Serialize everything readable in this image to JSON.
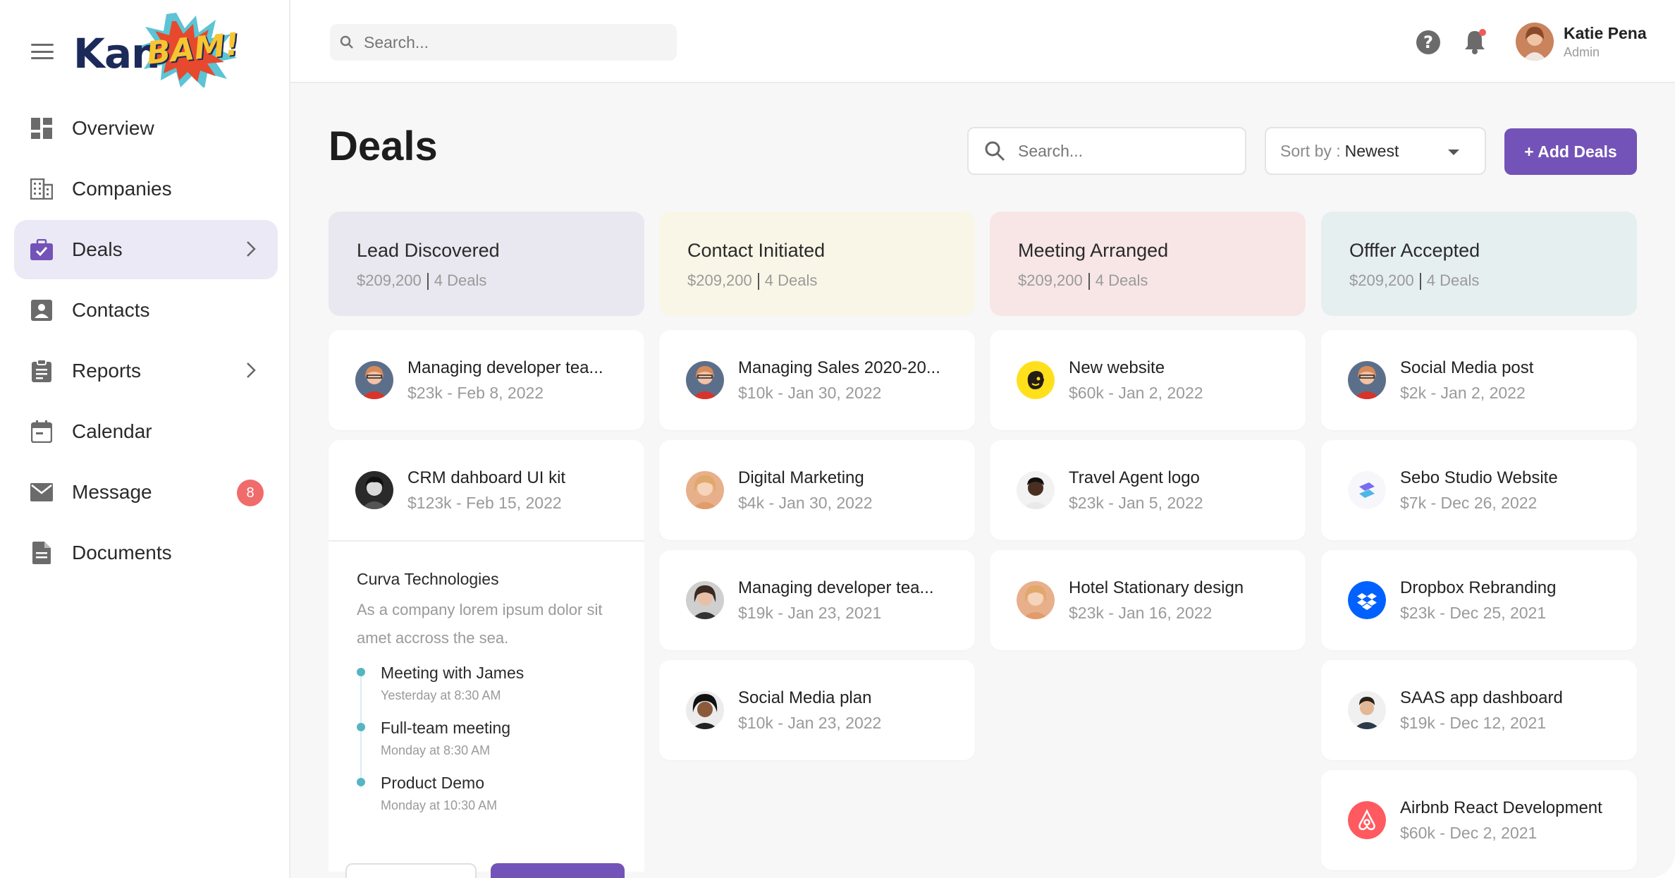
{
  "app": {
    "name_left": "Kan",
    "name_right": "BAM!"
  },
  "sidebar": {
    "items": [
      {
        "label": "Overview"
      },
      {
        "label": "Companies"
      },
      {
        "label": "Deals"
      },
      {
        "label": "Contacts"
      },
      {
        "label": "Reports"
      },
      {
        "label": "Calendar"
      },
      {
        "label": "Message",
        "badge": "8"
      },
      {
        "label": "Documents"
      }
    ]
  },
  "topbar": {
    "search_placeholder": "Search...",
    "user": {
      "name": "Katie Pena",
      "role": "Admin"
    }
  },
  "main": {
    "title": "Deals",
    "search_placeholder": "Search...",
    "sort": {
      "prefix": "Sort by :",
      "value": "Newest"
    },
    "add_label": "+ Add Deals"
  },
  "columns": [
    {
      "title": "Lead Discovered",
      "amount": "$209,200",
      "count": "4 Deals",
      "cards": [
        {
          "title": "Managing developer tea...",
          "meta": "$23k - Feb 8, 2022"
        },
        {
          "title": "CRM dahboard UI kit",
          "meta": "$123k - Feb 15, 2022"
        }
      ],
      "expanded": {
        "title": "Curva Technologies",
        "desc": "As a company lorem ipsum dolor sit amet accross the sea.",
        "timeline": [
          {
            "title": "Meeting with James",
            "time": "Yesterday at 8:30 AM"
          },
          {
            "title": "Full-team meeting",
            "time": "Monday at 8:30 AM"
          },
          {
            "title": "Product Demo",
            "time": "Monday at 10:30 AM"
          }
        ]
      }
    },
    {
      "title": "Contact Initiated",
      "amount": "$209,200",
      "count": "4 Deals",
      "cards": [
        {
          "title": "Managing Sales 2020-20...",
          "meta": "$10k - Jan 30, 2022"
        },
        {
          "title": "Digital Marketing",
          "meta": "$4k - Jan 30, 2022"
        },
        {
          "title": "Managing developer tea...",
          "meta": "$19k - Jan 23, 2021"
        },
        {
          "title": "Social Media plan",
          "meta": "$10k - Jan 23, 2022"
        }
      ]
    },
    {
      "title": "Meeting Arranged",
      "amount": "$209,200",
      "count": "4 Deals",
      "cards": [
        {
          "title": "New website",
          "meta": "$60k - Jan 2, 2022"
        },
        {
          "title": "Travel Agent logo",
          "meta": "$23k - Jan 5, 2022"
        },
        {
          "title": "Hotel Stationary design",
          "meta": "$23k - Jan 16, 2022"
        }
      ]
    },
    {
      "title": "Offfer Accepted",
      "amount": "$209,200",
      "count": "4 Deals",
      "cards": [
        {
          "title": "Social Media post",
          "meta": "$2k - Jan 2, 2022"
        },
        {
          "title": "Sebo Studio Website",
          "meta": "$7k - Dec 26, 2022"
        },
        {
          "title": "Dropbox Rebranding",
          "meta": "$23k - Dec 25, 2021"
        },
        {
          "title": "SAAS app dashboard",
          "meta": "$19k - Dec 12, 2021"
        },
        {
          "title": "Airbnb React Development",
          "meta": "$60k - Dec 2, 2021"
        }
      ]
    }
  ],
  "colors": {
    "accent": "#7353b7",
    "lead_bg": "#e9e7ef",
    "contact_bg": "#faf6e7",
    "meeting_bg": "#f8e6e6",
    "offer_bg": "#e6eff0",
    "badge": "#f06b6b"
  }
}
